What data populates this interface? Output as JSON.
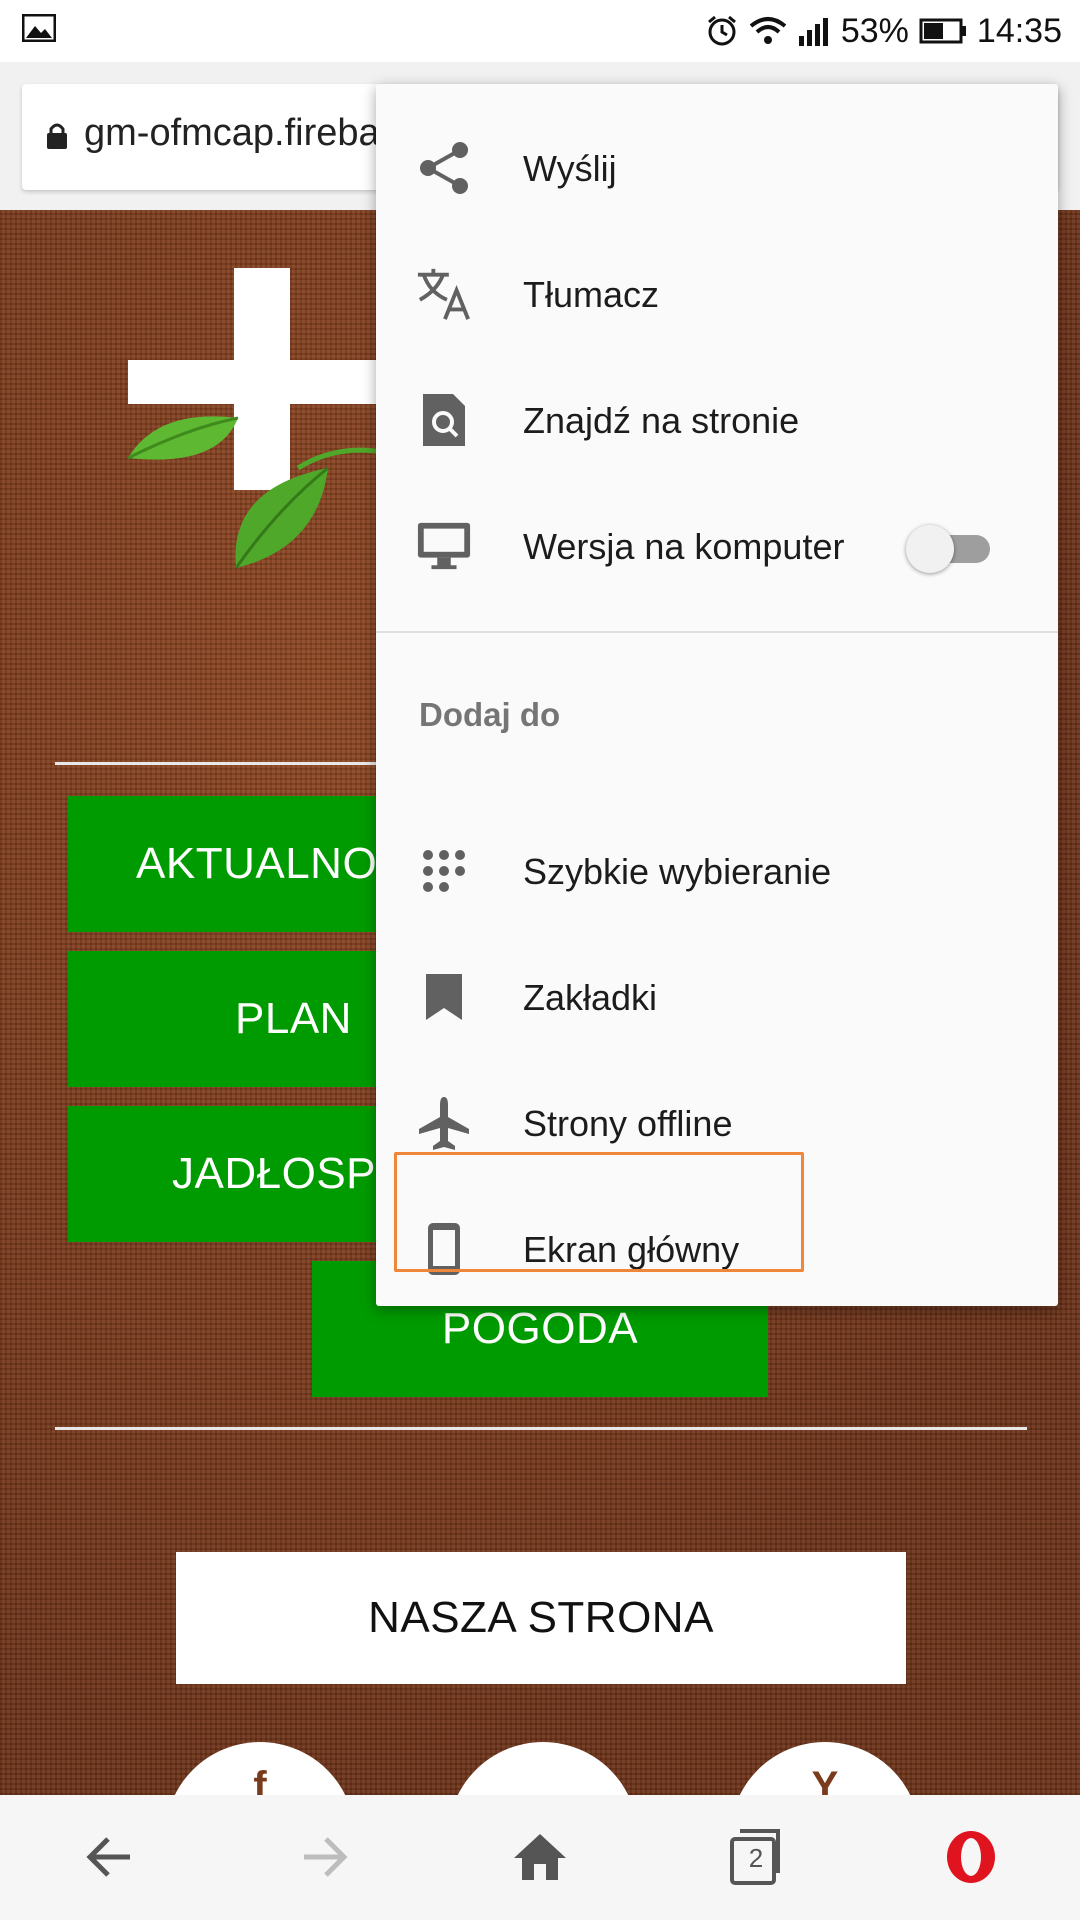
{
  "status_bar": {
    "battery_percent": "53%",
    "time": "14:35",
    "icons": [
      "image-icon",
      "alarm-icon",
      "wifi-icon",
      "signal-icon",
      "battery-icon"
    ]
  },
  "address_bar": {
    "url": "gm-ofmcap.fireba",
    "icon": "lock-icon"
  },
  "page": {
    "buttons": [
      "AKTUALNO",
      "PLAN",
      "JADŁOSP",
      "POGODA"
    ],
    "site_button": "NASZA STRONA",
    "social_icons": [
      "f",
      "",
      "Y"
    ],
    "colors": {
      "button_green": "#009b00",
      "background_brown": "#7a3a1c"
    }
  },
  "menu": {
    "items": [
      {
        "label": "Wyślij",
        "icon": "share-icon"
      },
      {
        "label": "Tłumacz",
        "icon": "translate-icon"
      },
      {
        "label": "Znajdź na stronie",
        "icon": "find-in-page-icon"
      },
      {
        "label": "Wersja na komputer",
        "icon": "desktop-icon",
        "toggle": false
      }
    ],
    "section_title": "Dodaj do",
    "add_items": [
      {
        "label": "Szybkie wybieranie",
        "icon": "speed-dial-icon"
      },
      {
        "label": "Zakładki",
        "icon": "bookmark-icon"
      },
      {
        "label": "Strony offline",
        "icon": "airplane-icon"
      },
      {
        "label": "Ekran główny",
        "icon": "phone-icon",
        "highlighted": true
      }
    ],
    "highlight_color": "#f0863a"
  },
  "bottom_nav": {
    "tab_count": "2",
    "icons": [
      "back-arrow-icon",
      "forward-arrow-icon",
      "home-icon",
      "tabs-icon",
      "opera-logo-icon"
    ]
  }
}
